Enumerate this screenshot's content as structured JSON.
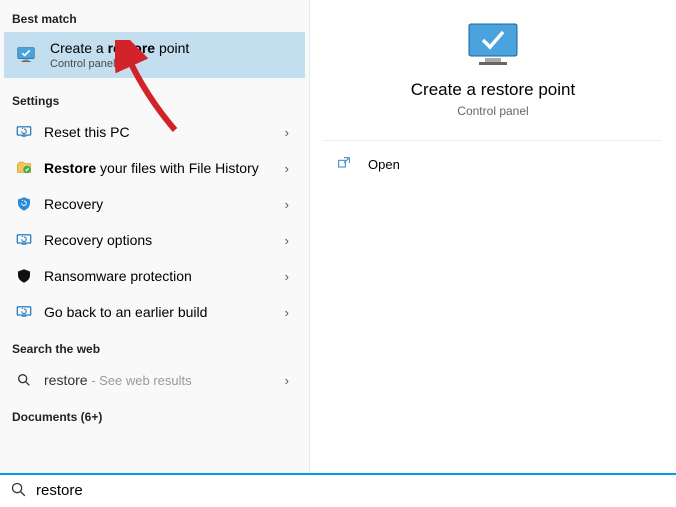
{
  "left": {
    "best_match_header": "Best match",
    "best_match": {
      "title_html": "Create a <b>restore</b> point",
      "subtitle": "Control panel"
    },
    "settings_header": "Settings",
    "settings": [
      {
        "icon": "reset-pc-icon",
        "label_html": "Reset this PC"
      },
      {
        "icon": "file-history-icon",
        "label_html": "<b>Restore</b> your files with File History"
      },
      {
        "icon": "recovery-icon",
        "label_html": "Recovery"
      },
      {
        "icon": "recovery-options-icon",
        "label_html": "Recovery options"
      },
      {
        "icon": "ransomware-icon",
        "label_html": "Ransomware protection"
      },
      {
        "icon": "go-back-build-icon",
        "label_html": "Go back to an earlier build"
      }
    ],
    "web_header": "Search the web",
    "web": {
      "query": "restore",
      "hint": " - See web results"
    },
    "documents_header": "Documents (6+)"
  },
  "preview": {
    "title": "Create a restore point",
    "subtitle": "Control panel",
    "open_label": "Open"
  },
  "search": {
    "value": "restore"
  },
  "colors": {
    "selection_bg": "#c3deef",
    "accent": "#0299ef",
    "annotation": "#d2232a"
  },
  "icons": {
    "reset-pc-icon": "monitor-refresh",
    "file-history-icon": "folder-shield",
    "recovery-icon": "shield-arrow",
    "recovery-options-icon": "monitor-refresh",
    "ransomware-icon": "shield-black",
    "go-back-build-icon": "monitor-refresh",
    "best-match-icon": "monitor-check",
    "search-icon": "magnifier",
    "open-icon": "open-external"
  }
}
